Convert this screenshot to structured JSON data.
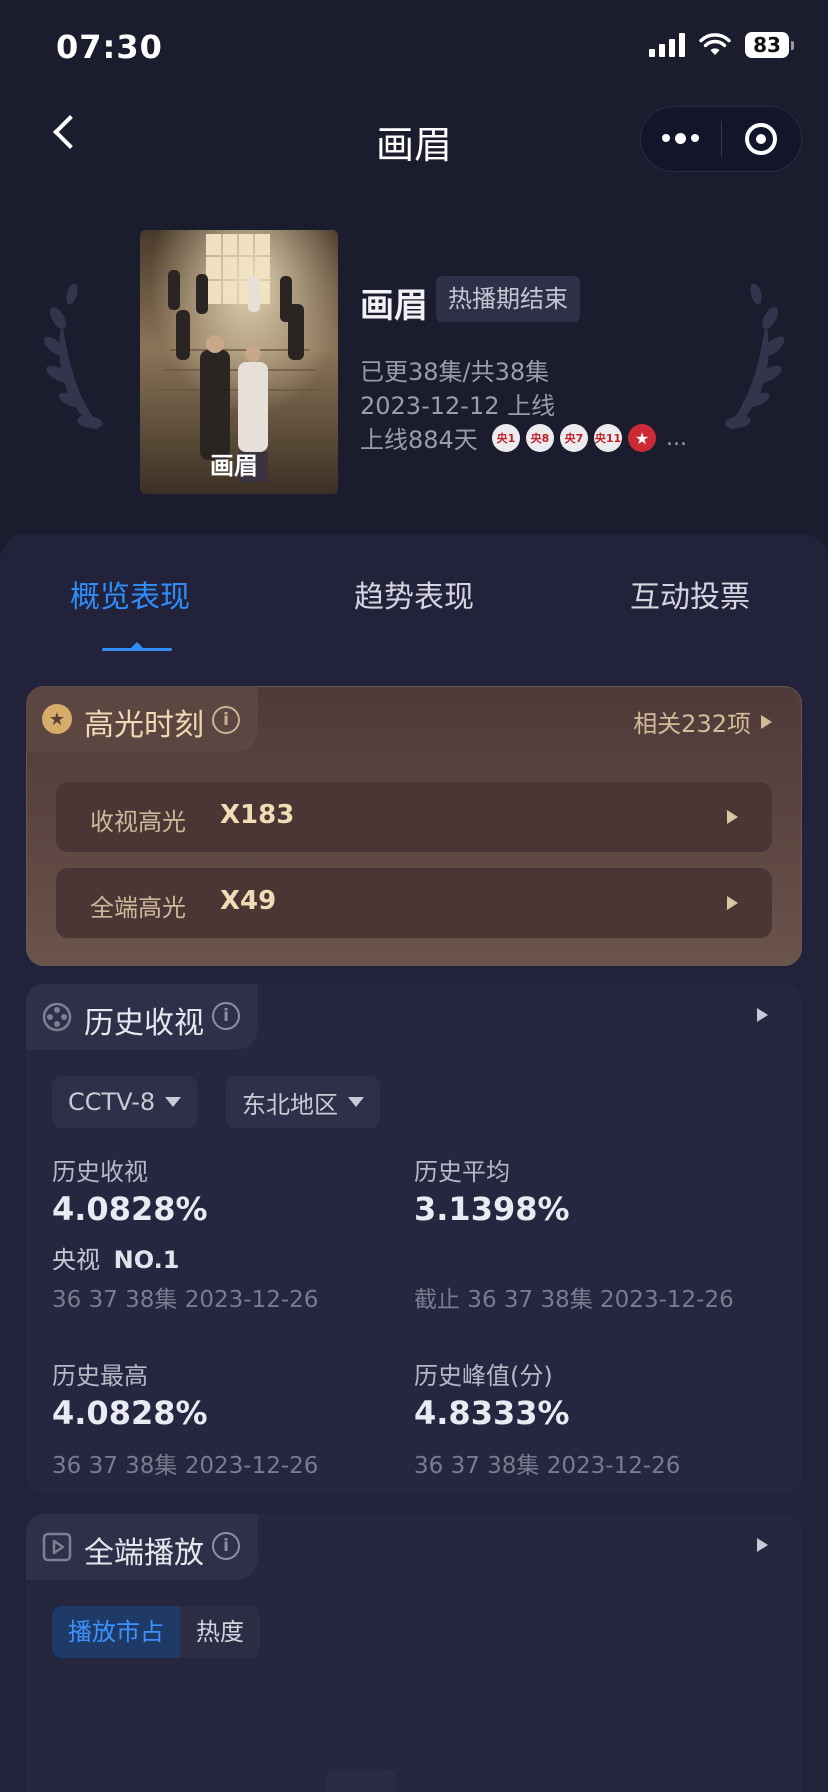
{
  "status_bar": {
    "time": "07:30",
    "battery": "83"
  },
  "nav": {
    "title": "画眉"
  },
  "show": {
    "title": "画眉",
    "status_tag": "热播期结束",
    "episodes": "已更38集/共38集",
    "release": "2023-12-12 上线",
    "days_online": "上线884天",
    "channels": [
      "央1",
      "央8",
      "央7",
      "央11"
    ],
    "more": "..."
  },
  "tabs": [
    {
      "label": "概览表现",
      "active": true
    },
    {
      "label": "趋势表现",
      "active": false
    },
    {
      "label": "互动投票",
      "active": false
    }
  ],
  "highlights": {
    "title": "高光时刻",
    "related": "相关232项",
    "rows": [
      {
        "label": "收视高光",
        "value": "X183"
      },
      {
        "label": "全端高光",
        "value": "X49"
      }
    ]
  },
  "ratings": {
    "title": "历史收视",
    "filters": {
      "channel": "CCTV-8",
      "region": "东北地区"
    },
    "stats": {
      "history": {
        "label": "历史收视",
        "value": "4.0828%",
        "rank_prefix": "央视",
        "rank": "NO.1",
        "sub": "36 37 38集 2023-12-26"
      },
      "average": {
        "label": "历史平均",
        "value": "3.1398%",
        "sub": "截止 36 37 38集 2023-12-26"
      },
      "highest": {
        "label": "历史最高",
        "value": "4.0828%",
        "sub": "36 37 38集 2023-12-26"
      },
      "peak": {
        "label": "历史峰值(分)",
        "value": "4.8333%",
        "sub": "36 37 38集 2023-12-26"
      }
    }
  },
  "playback": {
    "title": "全端播放",
    "segments": [
      {
        "label": "播放市占",
        "active": true
      },
      {
        "label": "热度",
        "active": false
      }
    ]
  },
  "colors": {
    "accent": "#2f8dfb",
    "gold": "#f0d9b3",
    "background": "#1b1c2e"
  }
}
